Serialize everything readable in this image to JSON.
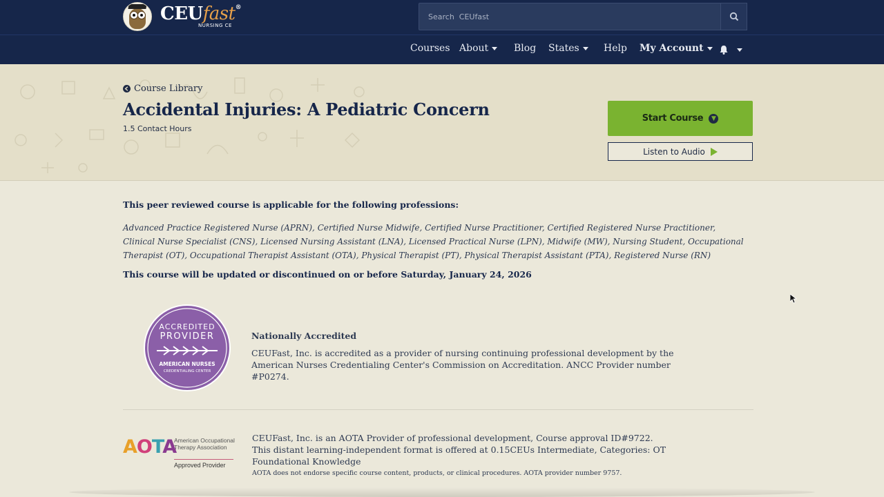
{
  "header": {
    "logo": {
      "name": "CEU",
      "name_accent": "fast",
      "registered": "®",
      "subtitle": "NURSING CE"
    },
    "search": {
      "placeholder": "Search  CEUfast",
      "icon": "search-icon"
    }
  },
  "nav": {
    "items": [
      {
        "label": "Courses",
        "dropdown": false
      },
      {
        "label": "About",
        "dropdown": true
      },
      {
        "label": "Blog",
        "dropdown": false
      },
      {
        "label": "States",
        "dropdown": true
      },
      {
        "label": "Help",
        "dropdown": false
      },
      {
        "label": "My Account",
        "dropdown": true
      }
    ],
    "notifications_icon": "bell-icon"
  },
  "course": {
    "back_label": "Course Library",
    "title": "Accidental Injuries: A Pediatric Concern",
    "hours": "1.5 Contact Hours",
    "start_label": "Start Course",
    "audio_label": "Listen to Audio"
  },
  "professions": {
    "heading": "This peer reviewed course is applicable for the following professions:",
    "list": "Advanced Practice Registered Nurse (APRN), Certified Nurse Midwife, Certified Nurse Practitioner, Certified Registered Nurse Practitioner, Clinical Nurse Specialist (CNS), Licensed Nursing Assistant (LNA), Licensed Practical Nurse (LPN), Midwife (MW), Nursing Student, Occupational Therapist (OT), Occupational Therapist Assistant (OTA), Physical Therapist (PT), Physical Therapist Assistant (PTA), Registered Nurse (RN)",
    "update_notice": "This course will be updated or discontinued on or before Saturday, January 24, 2026"
  },
  "accreditation": {
    "badge": {
      "line1": "ACCREDITED",
      "line2": "PROVIDER",
      "line3": "AMERICAN NURSES",
      "line4": "CREDENTIALING CENTER"
    },
    "title": "Nationally Accredited",
    "text": "CEUFast, Inc. is accredited as a provider of nursing continuing professional development by the American Nurses Credentialing Center's Commission on Accreditation. ANCC Provider number #P0274."
  },
  "aota": {
    "logo_letters": [
      "A",
      "O",
      "T",
      "A"
    ],
    "logo_colors": [
      "#e8a02a",
      "#d0407a",
      "#3aa0b0",
      "#8a3a90"
    ],
    "org_name": "American Occupational Therapy Association",
    "approved": "Approved Provider",
    "text": "CEUFast, Inc. is an AOTA Provider of professional development, Course approval ID#9722. This distant learning-independent format is offered at 0.15CEUs Intermediate, Categories: OT Foundational Knowledge",
    "note": "AOTA does not endorse specific course content, products, or clinical procedures. AOTA provider number 9757."
  },
  "colors": {
    "header_bg": "#16264a",
    "accent_green": "#7ab330",
    "page_bg": "#ebe8da",
    "hero_bg": "#e4dfc9",
    "badge_purple": "#8b5fa8"
  }
}
